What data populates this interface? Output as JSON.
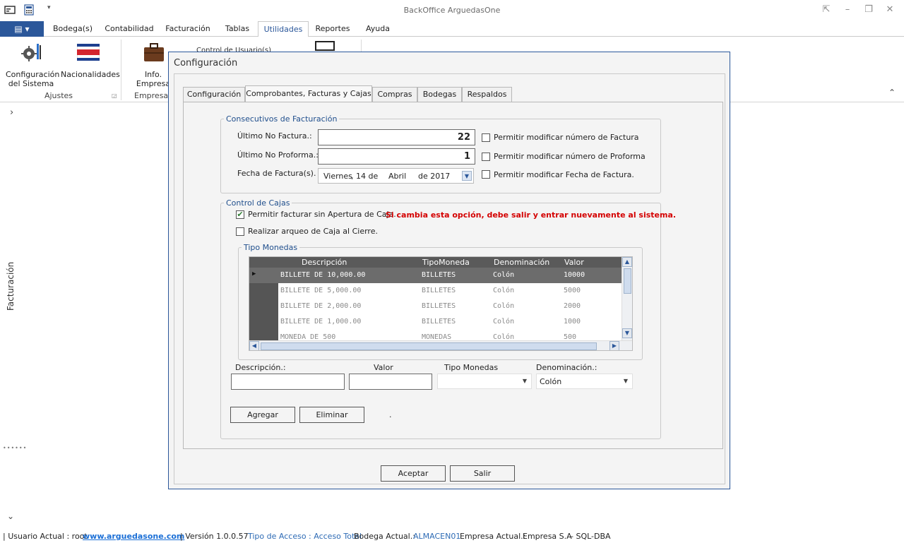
{
  "window": {
    "title": "BackOffice ArguedasOne"
  },
  "ribbon": {
    "tabs": [
      "Bodega(s)",
      "Contabilidad",
      "Facturación",
      "Tablas",
      "Utilidades",
      "Reportes",
      "Ayuda"
    ],
    "active_tab": "Utilidades",
    "items": {
      "config_line1": "Configuración",
      "config_line2": "del Sistema",
      "nationalities": "Nacionalidades",
      "info_line1": "Info.",
      "info_line2": "Empresa",
      "partial_item": "Control de Usuario(s)"
    },
    "groups": {
      "settings": "Ajustes",
      "company": "Empresa"
    }
  },
  "sidebar": {
    "label": "Facturación"
  },
  "dialog": {
    "title": "Configuración",
    "tabs": [
      "Configuración",
      "Comprobantes, Facturas y Cajas",
      "Compras",
      "Bodegas",
      "Respaldos"
    ],
    "active_tab": "Comprobantes, Facturas y Cajas",
    "invoice_group": {
      "legend": "Consecutivos de Facturación",
      "last_invoice_label": "Último No Factura.:",
      "last_invoice_value": "22",
      "last_proforma_label": "Último No Proforma.:",
      "last_proforma_value": "1",
      "date_label": "Fecha de Factura(s).",
      "date_weekday": "Viernes",
      "date_day": ", 14 de",
      "date_month": "Abril",
      "date_year": "de 2017",
      "allow_invoice_number": "Permitir modificar número de Factura",
      "allow_proforma_number": "Permitir modificar número de Proforma",
      "allow_invoice_date": "Permitir modificar Fecha de Factura."
    },
    "cash_group": {
      "legend": "Control de Cajas",
      "allow_without_opening": "Permitir facturar sin Apertura de Caja.",
      "allow_without_opening_checked": true,
      "warning": "Si cambia esta opción, debe salir y entrar nuevamente al sistema.",
      "cash_count": "Realizar arqueo de Caja al Cierre.",
      "currency_legend": "Tipo Monedas",
      "grid_headers": [
        "Descripción",
        "TipoMoneda",
        "Denominación",
        "Valor"
      ],
      "grid_rows": [
        [
          "BILLETE DE 10,000.00",
          "BILLETES",
          "Colón",
          "10000"
        ],
        [
          "BILLETE DE 5,000.00",
          "BILLETES",
          "Colón",
          "5000"
        ],
        [
          "BILLETE DE 2,000.00",
          "BILLETES",
          "Colón",
          "2000"
        ],
        [
          "BILLETE DE 1,000.00",
          "BILLETES",
          "Colón",
          "1000"
        ],
        [
          "MONEDA DE 500",
          "MONEDAS",
          "Colón",
          "500"
        ]
      ],
      "description_label": "Descripción.:",
      "value_label": "Valor",
      "currency_type_label": "Tipo Monedas",
      "denomination_label": "Denominación.:",
      "denomination_value": "Colón",
      "add_button": "Agregar",
      "delete_button": "Eliminar",
      "dot": "."
    },
    "accept_button": "Aceptar",
    "exit_button": "Salir"
  },
  "status": {
    "user": "| Usuario Actual : root",
    "website": "www.arguedasone.com",
    "version": "| Versión 1.0.0.57",
    "access": "Tipo de Acceso : Acceso Total",
    "warehouse_label": "Bodega Actual.:",
    "warehouse": "ALMACEN01",
    "company_label": "Empresa Actual.:",
    "company": "Empresa S.A",
    "db": "- SQL-DBA"
  },
  "colors": {
    "accent": "#2b579a",
    "warning": "#d40000",
    "link": "#1b6fd6"
  }
}
